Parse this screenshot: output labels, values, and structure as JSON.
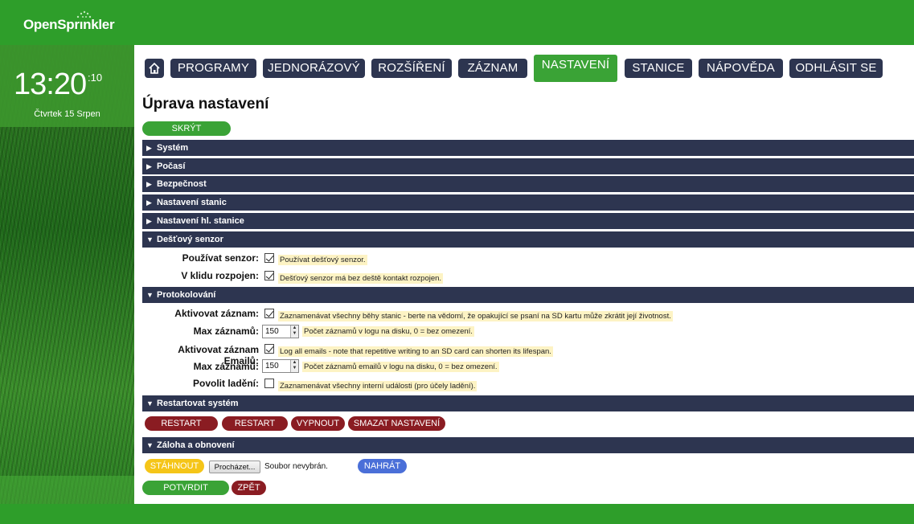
{
  "app": {
    "brand": "OpenSprinkler",
    "brand_a": "OpenSpr",
    "brand_b": "nkler"
  },
  "clock": {
    "time": "13:20",
    "seconds": ":10",
    "date": "Čtvrtek 15 Srpen"
  },
  "nav": {
    "home_icon": "home-icon",
    "items": [
      "PROGRAMY",
      "JEDNORÁZOVÝ",
      "ROZŠÍŘENÍ",
      "ZÁZNAM",
      "NASTAVENÍ",
      "STANICE",
      "NÁPOVĚDA",
      "ODHLÁSIT SE"
    ],
    "active": "NASTAVENÍ"
  },
  "page": {
    "title": "Úprava nastavení",
    "hide_help": "SKRÝT NÁPOVĚDU"
  },
  "sections": {
    "system": "Systém",
    "weather": "Počasí",
    "security": "Bezpečnost",
    "stations": "Nastavení stanic",
    "master": "Nastavení hl. stanice",
    "rain": "Dešťový senzor",
    "logging": "Protokolování",
    "restart": "Restartovat systém",
    "backup": "Záloha a obnovení"
  },
  "rain": {
    "use_label": "Používat senzor:",
    "use_help": "Používat dešťový senzor.",
    "use_checked": true,
    "nc_label": "V klidu rozpojen:",
    "nc_help": "Dešťový senzor má bez deště kontakt rozpojen.",
    "nc_checked": true
  },
  "logging": {
    "enable_label": "Aktivovat záznam:",
    "enable_help": "Zaznamenávat všechny běhy stanic - berte na vědomí, že opakující se psaní na SD kartu může zkrátit její životnost.",
    "enable_checked": true,
    "max_label": "Max záznamů:",
    "max_value": "150",
    "max_help": "Počet záznamů v logu na disku, 0 = bez omezení.",
    "email_label": "Aktivovat záznam Emailů:",
    "email_help": "Log all emails - note that repetitive writing to an SD card can shorten its lifespan.",
    "email_checked": true,
    "email_max_label": "Max záznamů:",
    "email_max_value": "150",
    "email_max_help": "Počet záznamů emailů v logu na disku, 0 = bez omezení.",
    "debug_label": "Povolit ladění:",
    "debug_help": "Zaznamenávat všechny interní události (pro účely ladění).",
    "debug_checked": false
  },
  "restart_buttons": [
    "RESTART OSPY",
    "RESTART HW",
    "VYPNOUT",
    "SMAZAT NASTAVENÍ"
  ],
  "backup": {
    "download": "STÁHNOUT",
    "browse": "Procházet...",
    "no_file": "Soubor nevybrán.",
    "upload": "NAHRÁT"
  },
  "footer_buttons": {
    "confirm": "POTVRDIT ZMĚNY",
    "back": "ZPĚT"
  },
  "colors": {
    "brand_green": "#2e9e2a",
    "nav_dark": "#2d3550",
    "danger": "#8a1c22",
    "download": "#f5c518",
    "upload": "#4a6fd8",
    "help_bg": "#fdf3c4"
  }
}
